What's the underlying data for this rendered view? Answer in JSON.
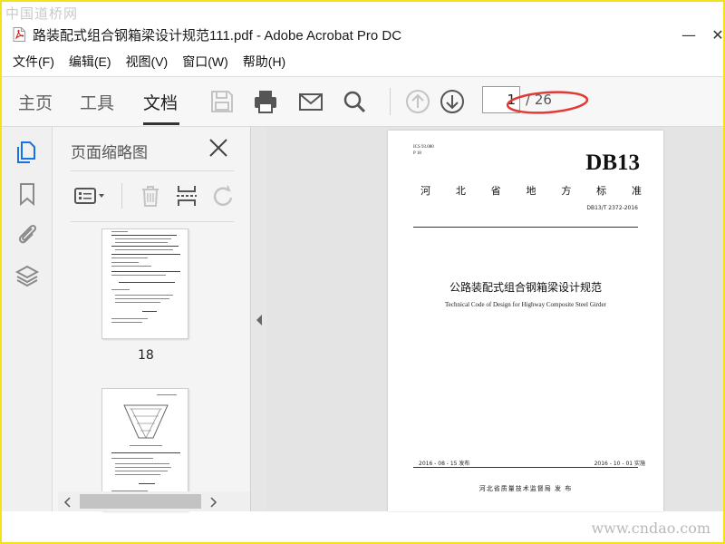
{
  "watermarks": {
    "top": "中国道桥网",
    "bottom": "www.cndao.com"
  },
  "window": {
    "title": "路装配式组合钢箱梁设计规范111.pdf - Adobe Acrobat Pro DC",
    "minimize_glyph": "—",
    "close_glyph": "✕"
  },
  "menu": [
    "文件(F)",
    "编辑(E)",
    "视图(V)",
    "窗口(W)",
    "帮助(H)"
  ],
  "toolbar": {
    "tabs": [
      "主页",
      "工具",
      "文档"
    ],
    "active_tab": "文档",
    "icons": [
      "save-icon",
      "print-icon",
      "email-icon",
      "search-icon",
      "prev-page-icon",
      "next-page-icon"
    ],
    "page_current": "1",
    "page_total": "/ 26",
    "highlight_color": "#e53935"
  },
  "sidebar_rail": {
    "icons": [
      "page-thumbnails-icon",
      "bookmark-icon",
      "attachment-icon",
      "layers-icon"
    ],
    "active_color": "#1473e6"
  },
  "thumbnails_panel": {
    "title": "页面缩略图",
    "tools": [
      "thumbnail-options-icon",
      "delete-icon",
      "insert-page-icon",
      "rotate-icon"
    ],
    "pages": [
      {
        "label": "18"
      },
      {
        "label": ""
      }
    ]
  },
  "document": {
    "ics": "ICS 93.080",
    "p": "P 18",
    "standard_code": "DB13",
    "standard_type": [
      "河",
      "北",
      "省",
      "地",
      "方",
      "标",
      "准"
    ],
    "number": "DB13/T 2372-2016",
    "title_cn": "公路装配式组合钢箱梁设计规范",
    "title_en": "Technical Code of Design for Highway Composite Steel Girder",
    "issue_date": "2016 - 08 - 15 发布",
    "impl_date": "2016 - 10 - 01 实施",
    "issuer": "河北省质量技术监督局    发 布"
  }
}
